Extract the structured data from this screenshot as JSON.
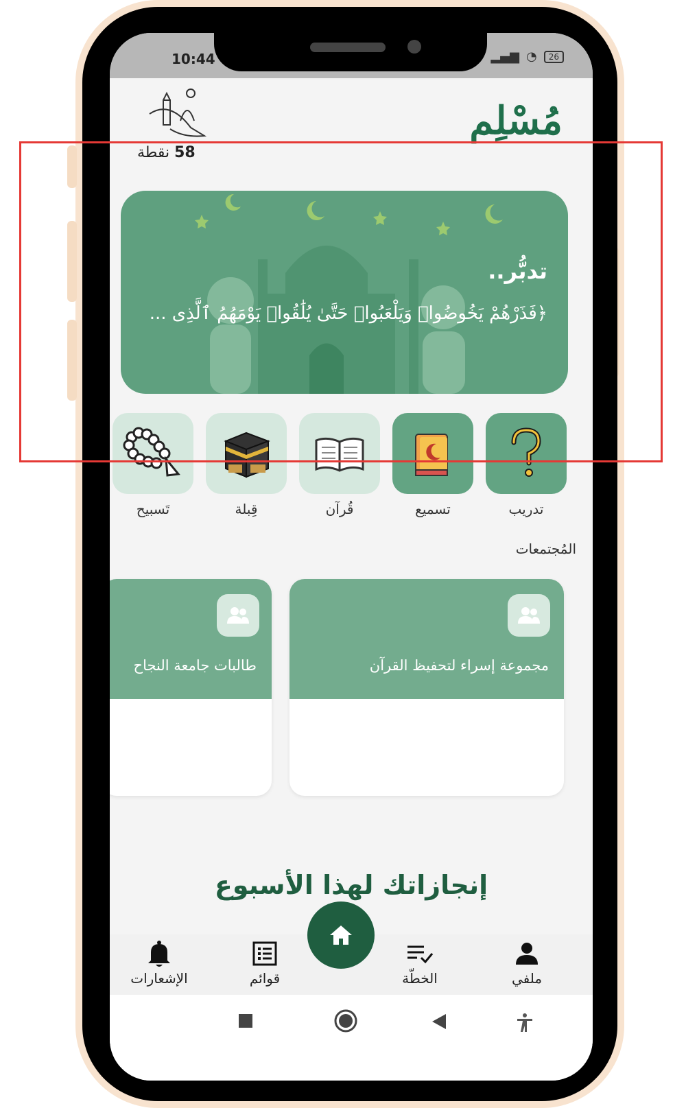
{
  "status_bar": {
    "time": "10:44",
    "battery": "26"
  },
  "header": {
    "app_name": "مُسْلِم",
    "points_value": "58",
    "points_unit": "نقطة"
  },
  "hero": {
    "title": "تدبُّر..",
    "verse": "﴿فَذَرْهُمْ يَخُوضُوا۟ وَيَلْعَبُوا۟ حَتَّىٰ يُلَٰقُوا۟ يَوْمَهُمُ ٱلَّذِى ..."
  },
  "shortcuts": [
    {
      "label": "تدريب",
      "icon": "question-mark-icon"
    },
    {
      "label": "تسميع",
      "icon": "book-crescent-icon"
    },
    {
      "label": "قُرآن",
      "icon": "open-quran-icon"
    },
    {
      "label": "قِبلة",
      "icon": "kaaba-icon"
    },
    {
      "label": "تَسبيح",
      "icon": "prayer-beads-icon"
    }
  ],
  "communities": {
    "title": "المُجتمعات",
    "groups": [
      {
        "name": "مجموعة إسراء لتحفيظ القرآن",
        "icon": "group-icon"
      },
      {
        "name": "طالبات جامعة النجاح",
        "icon": "group-icon"
      }
    ]
  },
  "achievements": {
    "title": "إنجازاتك لهذا الأسبوع"
  },
  "bottom_nav": [
    {
      "label": "ملفي",
      "icon": "profile-icon"
    },
    {
      "label": "الخطّة",
      "icon": "checklist-icon"
    },
    {
      "label": "قوائم",
      "icon": "list-icon"
    },
    {
      "label": "الإشعارات",
      "icon": "bell-icon"
    }
  ],
  "colors": {
    "primary": "#1f5e40",
    "card_green": "#63a483",
    "light_green": "#d5e8de",
    "annotation": "#e53935"
  }
}
